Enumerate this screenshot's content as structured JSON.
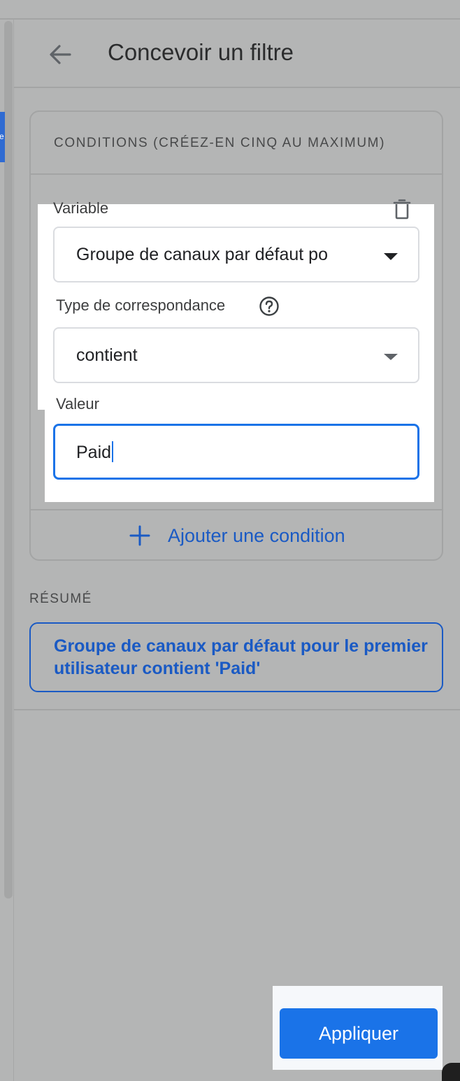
{
  "header": {
    "back_icon": "arrow-left-icon",
    "title": "Concevoir un filtre"
  },
  "conditions": {
    "header": "CONDITIONS (CRÉEZ-EN CINQ AU MAXIMUM)",
    "delete_icon": "trash-icon",
    "variable_label": "Variable",
    "variable_value": "Groupe de canaux par défaut po",
    "match_type_label": "Type de correspondance",
    "help_icon": "help-circle-icon",
    "match_type_value": "contient",
    "value_label": "Valeur",
    "value_input": "Paid",
    "add_icon": "plus-icon",
    "add_condition_label": "Ajouter une condition"
  },
  "summary": {
    "label": "RÉSUMÉ",
    "text": "Groupe de canaux par défaut pour le premier utilisateur contient 'Paid'"
  },
  "footer": {
    "apply_label": "Appliquer"
  },
  "colors": {
    "overlay_grey": "#b4b5b5",
    "accent_blue": "#1a73e8",
    "link_blue": "#1a5ac4",
    "surface_white": "#ffffff"
  }
}
